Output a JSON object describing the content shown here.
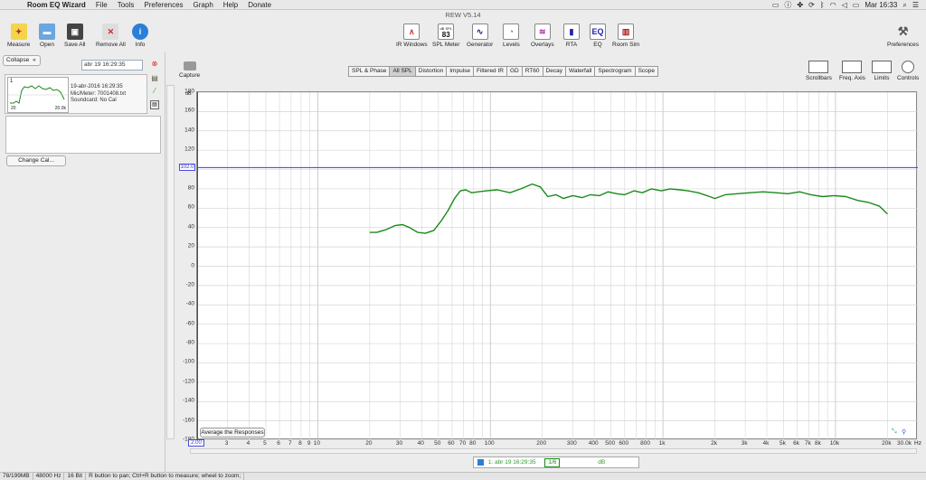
{
  "menubar": {
    "app_name": "Room EQ Wizard",
    "items": [
      "File",
      "Tools",
      "Preferences",
      "Graph",
      "Help",
      "Donate"
    ],
    "clock": "Mar 16:33"
  },
  "window": {
    "title": "REW V5.14"
  },
  "toolbar": {
    "left": [
      {
        "label": "Measure",
        "icon": "measure-icon"
      },
      {
        "label": "Open",
        "icon": "folder-icon"
      },
      {
        "label": "Save All",
        "icon": "save-icon"
      },
      {
        "label": "Remove All",
        "icon": "remove-icon"
      },
      {
        "label": "Info",
        "icon": "info-icon"
      }
    ],
    "center": [
      {
        "label": "IR Windows",
        "icon": "ir-windows-icon"
      },
      {
        "label": "SPL Meter",
        "icon": "spl-meter-icon",
        "value": "83",
        "unit": "dB SPL"
      },
      {
        "label": "Generator",
        "icon": "generator-icon"
      },
      {
        "label": "Levels",
        "icon": "levels-icon"
      },
      {
        "label": "Overlays",
        "icon": "overlays-icon"
      },
      {
        "label": "RTA",
        "icon": "rta-icon"
      },
      {
        "label": "EQ",
        "icon": "eq-icon"
      },
      {
        "label": "Room Sim",
        "icon": "room-sim-icon"
      }
    ],
    "preferences": "Preferences"
  },
  "leftpanel": {
    "collapse_label": "Collapse",
    "date_field": "abr 19 16:29:35",
    "measurement": {
      "index": "1",
      "date": "19-abr-2016 16:29:35",
      "mic": "Mic/Meter: 7001408.txt",
      "soundcard": "Soundcard: No Cal",
      "thumb_x_start": "20",
      "thumb_x_end": "20.0k"
    },
    "change_cal_label": "Change Cal..."
  },
  "capture_label": "Capture",
  "graph_tabs": [
    {
      "label": "SPL & Phase",
      "active": false
    },
    {
      "label": "All SPL",
      "active": true
    },
    {
      "label": "Distortion",
      "active": false
    },
    {
      "label": "Impulse",
      "active": false
    },
    {
      "label": "Filtered IR",
      "active": false
    },
    {
      "label": "GD",
      "active": false
    },
    {
      "label": "RT60",
      "active": false
    },
    {
      "label": "Decay",
      "active": false
    },
    {
      "label": "Waterfall",
      "active": false
    },
    {
      "label": "Spectrogram",
      "active": false
    },
    {
      "label": "Scope",
      "active": false
    }
  ],
  "right_tools": [
    "Scrollbars",
    "Freq. Axis",
    "Limits",
    "Controls"
  ],
  "plot": {
    "y_unit": "dB",
    "x_unit": "Hz",
    "y_cursor": "102.0",
    "x_cursor": "2.00",
    "avg_button": "Average the Responses"
  },
  "legend": {
    "label": "1: abr 19 16:29:35",
    "smoothing": "1/6",
    "unit": "dB",
    "color": "#1a8a1a"
  },
  "statusbar": {
    "memory": "78/199MB",
    "rate": "48000 Hz",
    "bits": "16 Bit",
    "hint": "R button to pan; Ctrl+R button to measure; wheel to zoom;"
  },
  "chart_data": {
    "type": "line",
    "title": "",
    "xlabel": "Hz",
    "ylabel": "dB",
    "xscale": "log",
    "xlim": [
      2,
      30000
    ],
    "ylim": [
      -180,
      180
    ],
    "yticks": [
      180,
      160,
      140,
      120,
      100,
      80,
      60,
      40,
      20,
      0,
      -20,
      -40,
      -60,
      -80,
      -100,
      -120,
      -140,
      -160,
      -180
    ],
    "xticks": [
      {
        "v": 3,
        "l": "3"
      },
      {
        "v": 4,
        "l": "4"
      },
      {
        "v": 5,
        "l": "5"
      },
      {
        "v": 6,
        "l": "6"
      },
      {
        "v": 7,
        "l": "7"
      },
      {
        "v": 8,
        "l": "8"
      },
      {
        "v": 9,
        "l": "9"
      },
      {
        "v": 10,
        "l": "10"
      },
      {
        "v": 20,
        "l": "20"
      },
      {
        "v": 30,
        "l": "30"
      },
      {
        "v": 40,
        "l": "40"
      },
      {
        "v": 50,
        "l": "50"
      },
      {
        "v": 60,
        "l": "60"
      },
      {
        "v": 70,
        "l": "70"
      },
      {
        "v": 80,
        "l": "80"
      },
      {
        "v": 100,
        "l": "100"
      },
      {
        "v": 200,
        "l": "200"
      },
      {
        "v": 300,
        "l": "300"
      },
      {
        "v": 400,
        "l": "400"
      },
      {
        "v": 500,
        "l": "500"
      },
      {
        "v": 600,
        "l": "600"
      },
      {
        "v": 800,
        "l": "800"
      },
      {
        "v": 1000,
        "l": "1k"
      },
      {
        "v": 2000,
        "l": "2k"
      },
      {
        "v": 3000,
        "l": "3k"
      },
      {
        "v": 4000,
        "l": "4k"
      },
      {
        "v": 5000,
        "l": "5k"
      },
      {
        "v": 6000,
        "l": "6k"
      },
      {
        "v": 7000,
        "l": "7k"
      },
      {
        "v": 8000,
        "l": "8k"
      },
      {
        "v": 10000,
        "l": "10k"
      },
      {
        "v": 20000,
        "l": "20k"
      },
      {
        "v": 30000,
        "l": "30.0k"
      }
    ],
    "series": [
      {
        "color": "#1a8a1a",
        "x": [
          20,
          22,
          25,
          28,
          31,
          34,
          38,
          42,
          47,
          52,
          57,
          62,
          67,
          72,
          78,
          85,
          95,
          110,
          130,
          150,
          175,
          195,
          215,
          240,
          265,
          300,
          340,
          380,
          430,
          480,
          540,
          600,
          680,
          760,
          860,
          980,
          1100,
          1250,
          1400,
          1600,
          1800,
          2000,
          2300,
          2700,
          3200,
          3800,
          4500,
          5300,
          6200,
          7200,
          8400,
          9800,
          11500,
          13500,
          15500,
          18000,
          20000
        ],
        "y": [
          35,
          35,
          38,
          42,
          43,
          40,
          35,
          34,
          37,
          47,
          58,
          70,
          78,
          79,
          76,
          77,
          78,
          79,
          76,
          80,
          85,
          82,
          72,
          74,
          70,
          73,
          71,
          74,
          73,
          77,
          75,
          74,
          78,
          76,
          80,
          78,
          80,
          79,
          78,
          76,
          73,
          70,
          74,
          75,
          76,
          77,
          76,
          75,
          77,
          74,
          72,
          73,
          72,
          68,
          66,
          62,
          54
        ]
      }
    ]
  }
}
